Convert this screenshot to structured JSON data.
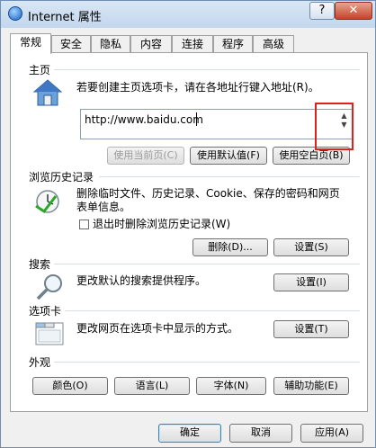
{
  "window": {
    "title": "Internet 属性",
    "help_label": "?",
    "close_label": "✕"
  },
  "tabs": [
    {
      "label": "常规"
    },
    {
      "label": "安全"
    },
    {
      "label": "隐私"
    },
    {
      "label": "内容"
    },
    {
      "label": "连接"
    },
    {
      "label": "程序"
    },
    {
      "label": "高级"
    }
  ],
  "home": {
    "title": "主页",
    "description": "若要创建主页选项卡，请在各地址行键入地址(R)。",
    "url": "http://www.baidu.com",
    "btn_current": "使用当前页(C)",
    "btn_default": "使用默认值(F)",
    "btn_blank": "使用空白页(B)"
  },
  "history": {
    "title": "浏览历史记录",
    "description_line1": "删除临时文件、历史记录、Cookie、保存的密码和网页",
    "description_line2": "表单信息。",
    "checkbox_label": "退出时删除浏览历史记录(W)",
    "btn_delete": "删除(D)...",
    "btn_settings": "设置(S)"
  },
  "search": {
    "title": "搜索",
    "description": "更改默认的搜索提供程序。",
    "btn_settings": "设置(I)"
  },
  "tabs_section": {
    "title": "选项卡",
    "description": "更改网页在选项卡中显示的方式。",
    "btn_settings": "设置(T)"
  },
  "appearance": {
    "title": "外观",
    "btn_colors": "颜色(O)",
    "btn_languages": "语言(L)",
    "btn_fonts": "字体(N)",
    "btn_accessibility": "辅助功能(E)"
  },
  "footer": {
    "ok": "确定",
    "cancel": "取消",
    "apply": "应用(A)"
  },
  "scroll": {
    "up": "▲",
    "down": "▼"
  }
}
